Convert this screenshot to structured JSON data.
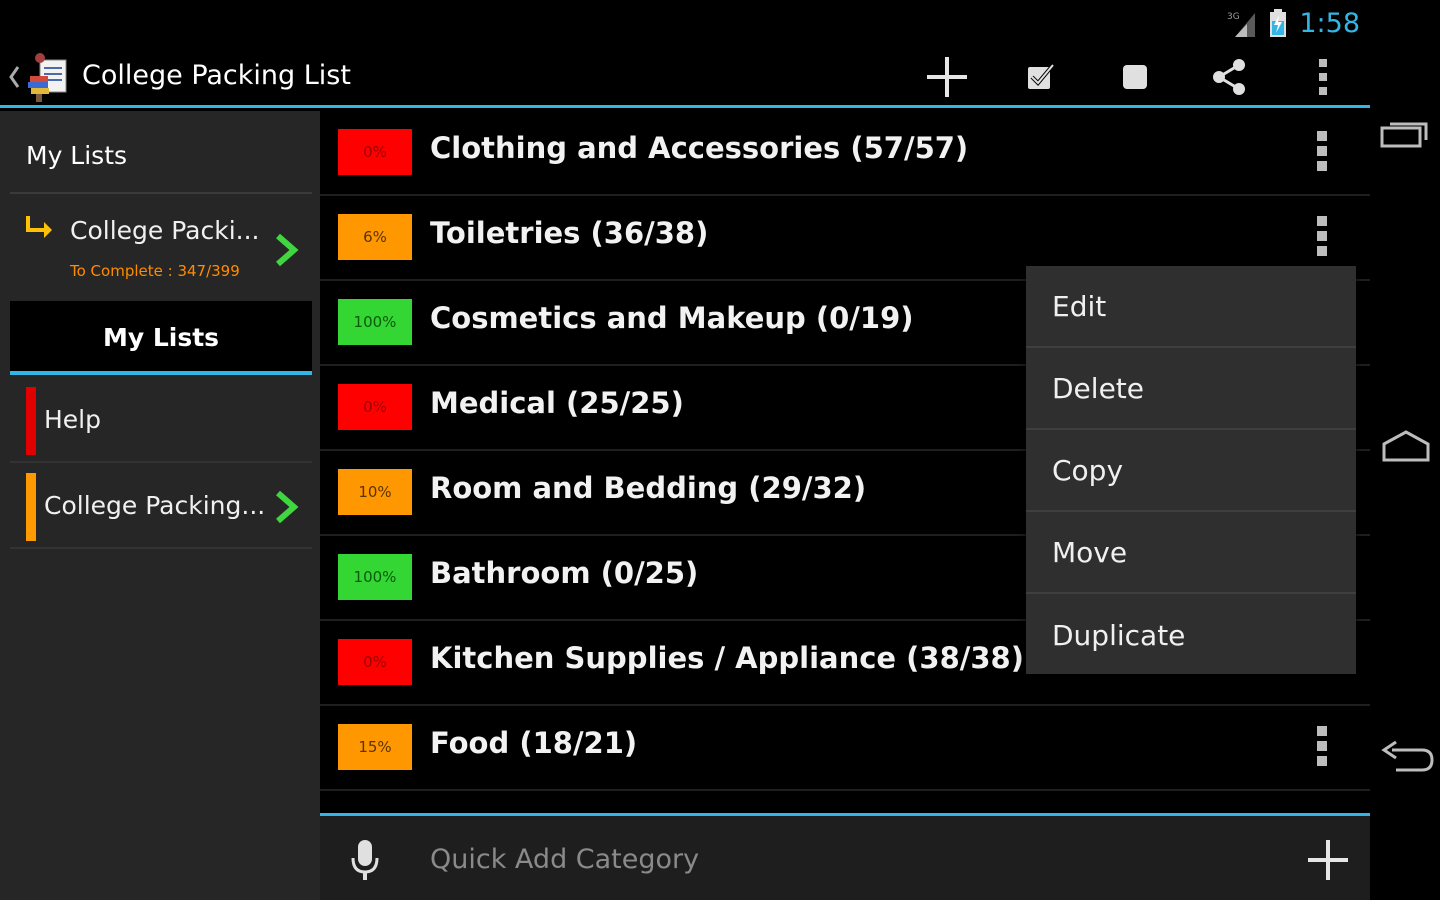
{
  "status_bar": {
    "time": "1:58",
    "network_label": "3G",
    "signal_icon": "signal-icon",
    "battery_icon": "battery-icon",
    "accent_color": "#33b5e5"
  },
  "action_bar": {
    "title": "College Packing List",
    "actions": [
      "add-icon",
      "checkbox-icon",
      "square-icon",
      "share-icon",
      "overflow-icon"
    ]
  },
  "sidebar": {
    "header": "My Lists",
    "current_list": {
      "name": "College Packi...",
      "subtitle": "To Complete : 347/399"
    },
    "tab": "My Lists",
    "items": [
      {
        "label": "Help",
        "color": "#e00000"
      },
      {
        "label": "College Packing...",
        "color": "#ff9a00"
      }
    ]
  },
  "categories": [
    {
      "label": "Clothing  and Accessories (57/57)",
      "percent": "0%",
      "color": "#ff0000",
      "text_color": "#9c0000"
    },
    {
      "label": "Toiletries (36/38)",
      "percent": "6%",
      "color": "#ff9800",
      "text_color": "#5a3300"
    },
    {
      "label": "Cosmetics and Makeup (0/19)",
      "percent": "100%",
      "color": "#33d633",
      "text_color": "#0a5a0a"
    },
    {
      "label": "Medical (25/25)",
      "percent": "0%",
      "color": "#ff0000",
      "text_color": "#9c0000"
    },
    {
      "label": "Room and Bedding (29/32)",
      "percent": "10%",
      "color": "#ff9800",
      "text_color": "#5a3300"
    },
    {
      "label": "Bathroom (0/25)",
      "percent": "100%",
      "color": "#33d633",
      "text_color": "#0a5a0a"
    },
    {
      "label": "Kitchen Supplies / Appliance (38/38)",
      "percent": "0%",
      "color": "#ff0000",
      "text_color": "#9c0000"
    },
    {
      "label": "Food (18/21)",
      "percent": "15%",
      "color": "#ff9800",
      "text_color": "#5a3300"
    }
  ],
  "quick_add": {
    "placeholder": "Quick Add Category"
  },
  "context_menu": {
    "items": [
      "Edit",
      "Delete",
      "Copy",
      "Move",
      "Duplicate"
    ]
  }
}
